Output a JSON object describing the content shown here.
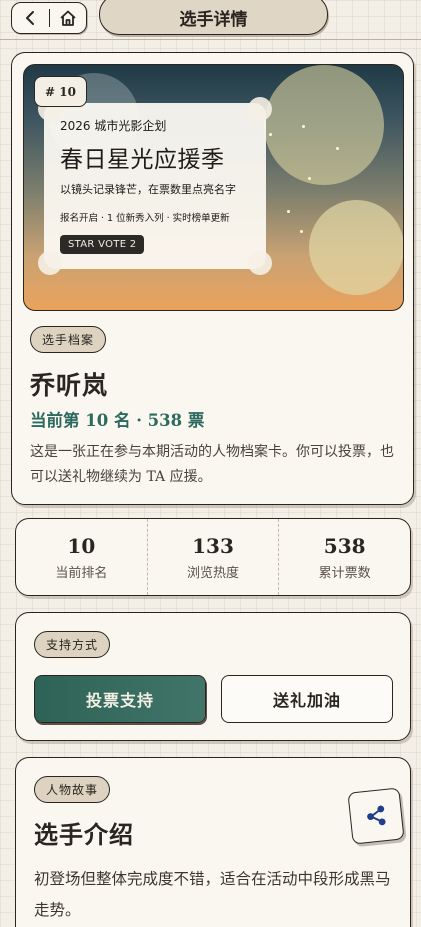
{
  "header": {
    "title": "选手详情",
    "back_icon": "chevron-left-icon",
    "home_icon": "home-icon"
  },
  "hero": {
    "rank_badge": "# 10",
    "poster": {
      "kicker": "2026 城市光影企划",
      "title": "春日星光应援季",
      "subtitle": "以镜头记录锋芒，在票数里点亮名字",
      "meta": "报名开启 · 1 位新秀入列 · 实时榜单更新",
      "badge": "STAR VOTE 2"
    }
  },
  "profile": {
    "tag": "选手档案",
    "name": "乔听岚",
    "rank_line": "当前第 10 名 · 538 票",
    "description": "这是一张正在参与本期活动的人物档案卡。你可以投票，也可以送礼物继续为 TA 应援。"
  },
  "stats": [
    {
      "value": "10",
      "label": "当前排名"
    },
    {
      "value": "133",
      "label": "浏览热度"
    },
    {
      "value": "538",
      "label": "累计票数"
    }
  ],
  "support": {
    "tag": "支持方式",
    "vote_label": "投票支持",
    "gift_label": "送礼加油"
  },
  "intro": {
    "tag": "人物故事",
    "title": "选手介绍",
    "text": "初登场但整体完成度不错，适合在活动中段形成黑马走势。",
    "share_icon": "share-icon"
  },
  "colors": {
    "accent": "#2d6356",
    "tag_bg": "#ddd3c0",
    "paper": "#faf7f1"
  }
}
